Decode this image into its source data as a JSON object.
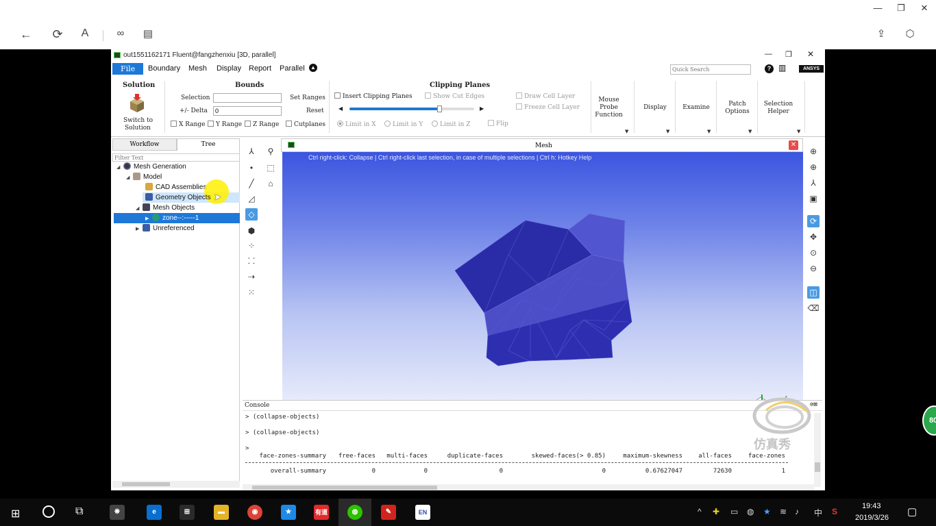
{
  "viewer": {
    "controls": [
      "—",
      "❐",
      "✕"
    ],
    "nav_icons": [
      "back-icon",
      "refresh-icon",
      "read-aloud-icon",
      "link-icon",
      "frame-icon",
      "share-icon",
      "cube-icon"
    ]
  },
  "window": {
    "title": "out1551162171 Fluent@fangzhenxiu  [3D, parallel]",
    "quick_search_placeholder": "Quick Search",
    "brand": "ANSYS"
  },
  "menu": {
    "file": "File",
    "items": [
      "Boundary",
      "Mesh",
      "Display",
      "Report",
      "Parallel"
    ]
  },
  "ribbon": {
    "solution": {
      "title": "Solution",
      "switch_label_1": "Switch to",
      "switch_label_2": "Solution"
    },
    "bounds": {
      "title": "Bounds",
      "selection_label": "Selection",
      "selection_value": "",
      "delta_label": "+/- Delta",
      "delta_value": "0",
      "set_ranges": "Set Ranges",
      "reset": "Reset",
      "x_range": "X Range",
      "y_range": "Y Range",
      "z_range": "Z Range"
    },
    "clipping": {
      "title": "Clipping Planes",
      "insert": "Insert Clipping Planes",
      "show_cut_edges": "Show Cut Edges",
      "cutplanes": "Cutplanes",
      "limit_x": "Limit in X",
      "limit_y": "Limit in Y",
      "limit_z": "Limit in Z",
      "flip": "Flip",
      "draw_cell_layer": "Draw Cell Layer",
      "freeze_cell_layer": "Freeze Cell Layer",
      "slider_value": 0.72
    },
    "buttons": {
      "mouse_probe_1": "Mouse",
      "mouse_probe_2": "Probe",
      "mouse_probe_3": "Function",
      "display": "Display",
      "examine": "Examine",
      "patch_1": "Patch",
      "patch_2": "Options",
      "selection_helper_1": "Selection",
      "selection_helper_2": "Helper"
    }
  },
  "tree": {
    "tabs": [
      "Workflow",
      "Tree"
    ],
    "filter_placeholder": "Filter Text",
    "nodes": {
      "mesh_generation": "Mesh Generation",
      "model": "Model",
      "cad": "CAD Assemblies",
      "geometry": "Geometry Objects",
      "mesh_objects": "Mesh Objects",
      "zone": "zone--:-----1",
      "unreferenced": "Unreferenced"
    }
  },
  "graphics": {
    "title": "Mesh",
    "hint": "Ctrl right-click: Collapse | Ctrl right-click last selection, in case of multiple selections | Ctrl h: Hotkey Help"
  },
  "console": {
    "title": "Console",
    "lines": [
      "> (collapse-objects)",
      "> (collapse-objects)",
      ">"
    ],
    "headers": [
      "face-zones-summary",
      "free-faces",
      "multi-faces",
      "duplicate-faces",
      "skewed-faces(> 0.85)",
      "maximum-skewness",
      "all-faces",
      "face-zones"
    ],
    "row": [
      "overall-summary",
      "0",
      "0",
      "0",
      "0",
      "0.67627047",
      "72630",
      "1"
    ],
    "watermark": "仿真秀"
  },
  "taskbar": {
    "time": "19:43",
    "date": "2019/3/26",
    "ime": "中",
    "badge": "80",
    "app_labels": {
      "youdao": "有道",
      "en": "EN"
    }
  },
  "colors": {
    "accent": "#1e78d8",
    "mesh_front": "#2e2fb0",
    "mesh_top": "#5a5ed8"
  }
}
